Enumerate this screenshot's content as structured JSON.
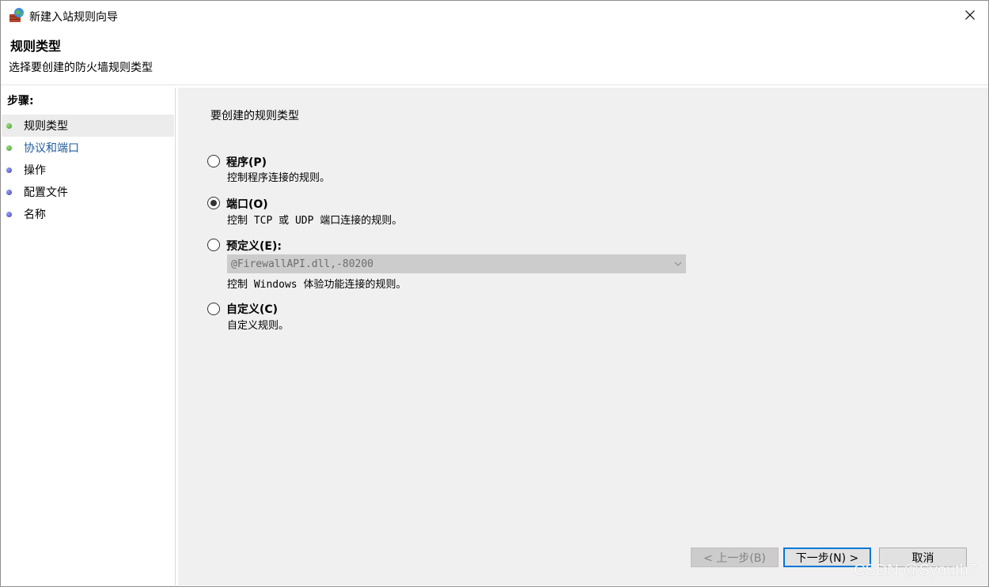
{
  "window": {
    "title": "新建入站规则向导",
    "close_symbol": "✕"
  },
  "header": {
    "title": "规则类型",
    "subtitle": "选择要创建的防火墙规则类型"
  },
  "steps": {
    "heading": "步骤:",
    "items": [
      {
        "label": "规则类型",
        "status": "done",
        "active": true
      },
      {
        "label": "协议和端口",
        "status": "done",
        "active": false
      },
      {
        "label": "操作",
        "status": "pending",
        "active": false
      },
      {
        "label": "配置文件",
        "status": "pending",
        "active": false
      },
      {
        "label": "名称",
        "status": "pending",
        "active": false
      }
    ]
  },
  "content": {
    "prompt": "要创建的规则类型",
    "options": [
      {
        "label": "程序(P)",
        "description": "控制程序连接的规则。",
        "checked": false
      },
      {
        "label": "端口(O)",
        "description": "控制 TCP 或 UDP 端口连接的规则。",
        "checked": true
      },
      {
        "label": "预定义(E):",
        "description": "控制 Windows 体验功能连接的规则。",
        "checked": false
      },
      {
        "label": "自定义(C)",
        "description": "自定义规则。",
        "checked": false
      }
    ],
    "predefined_select": {
      "value": "@FirewallAPI.dll,-80200",
      "disabled": true
    }
  },
  "buttons": {
    "back": "< 上一步(B)",
    "next": "下一步(N) >",
    "cancel": "取消"
  },
  "watermark": "CSDN @Syouth7",
  "colors": {
    "step_done_dot": "#3b9a2a",
    "step_pending_dot": "#3b3fa6",
    "link": "#1f5a9c",
    "focus_border": "#0078d7",
    "content_bg": "#f0f0f0"
  }
}
